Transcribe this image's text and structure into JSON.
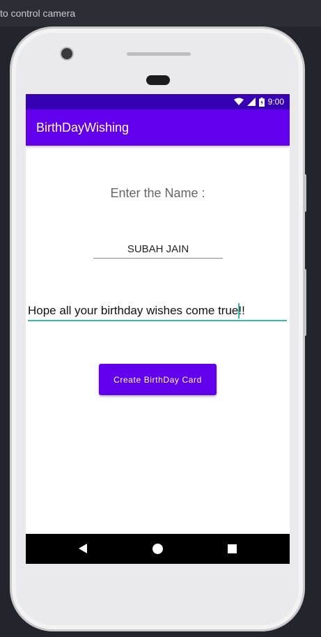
{
  "window": {
    "hint_text": "to control camera"
  },
  "status_bar": {
    "time": "9:00"
  },
  "app_bar": {
    "title": "BirthDayWishing"
  },
  "form": {
    "name_label": "Enter the Name :",
    "name_value": "SUBAH JAIN",
    "wish_value": "Hope all your birthday wishes come true!!",
    "create_button_label": "Create BirthDay Card"
  },
  "colors": {
    "primary": "#6200ee",
    "primary_dark": "#3700b3",
    "accent": "#2bc0a6"
  },
  "icons": [
    "wifi-icon",
    "cell-signal-icon",
    "battery-icon",
    "back-icon",
    "home-icon",
    "recents-icon"
  ]
}
